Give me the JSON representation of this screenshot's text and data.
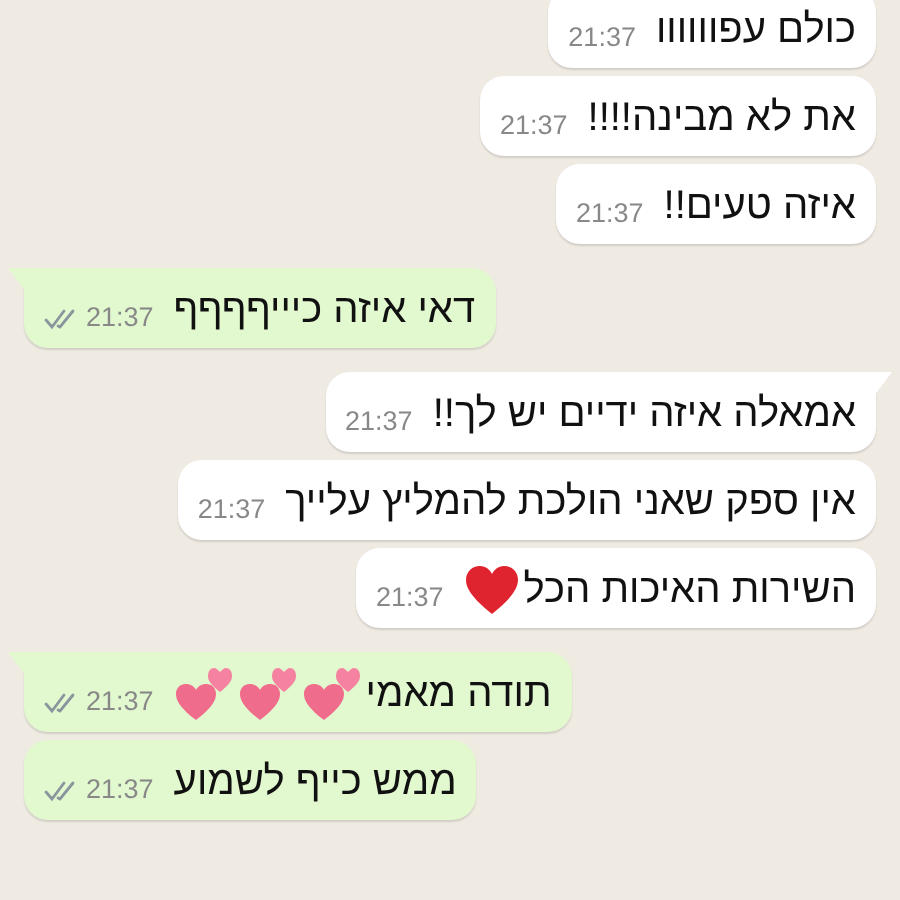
{
  "messages": [
    {
      "kind": "incoming",
      "text": "כולם עפוווווו",
      "time": "21:37",
      "tail": false
    },
    {
      "kind": "incoming",
      "text": "את לא מבינה!!!!",
      "time": "21:37",
      "tail": false
    },
    {
      "kind": "incoming",
      "text": "איזה טעים!!",
      "time": "21:37",
      "tail": false
    },
    {
      "kind": "outgoing",
      "text": "דאי איזה כיייףףףף",
      "time": "21:37",
      "tail": true,
      "delivered": true
    },
    {
      "kind": "incoming",
      "text": "אמאלה איזה ידיים יש לך!!",
      "time": "21:37",
      "tail": true
    },
    {
      "kind": "incoming",
      "text": "אין ספק שאני הולכת להמליץ עלייך",
      "time": "21:37",
      "tail": false
    },
    {
      "kind": "incoming",
      "text": "השירות האיכות הכל",
      "emoji": [
        {
          "kind": "heart"
        }
      ],
      "time": "21:37",
      "tail": false
    },
    {
      "kind": "outgoing",
      "text": "תודה מאמי",
      "emoji": [
        {
          "kind": "twohearts"
        },
        {
          "kind": "twohearts"
        },
        {
          "kind": "twohearts"
        }
      ],
      "time": "21:37",
      "tail": true,
      "delivered": true
    },
    {
      "kind": "outgoing",
      "text": "ממש כייף לשמוע",
      "time": "21:37",
      "tail": false,
      "delivered": true
    }
  ]
}
